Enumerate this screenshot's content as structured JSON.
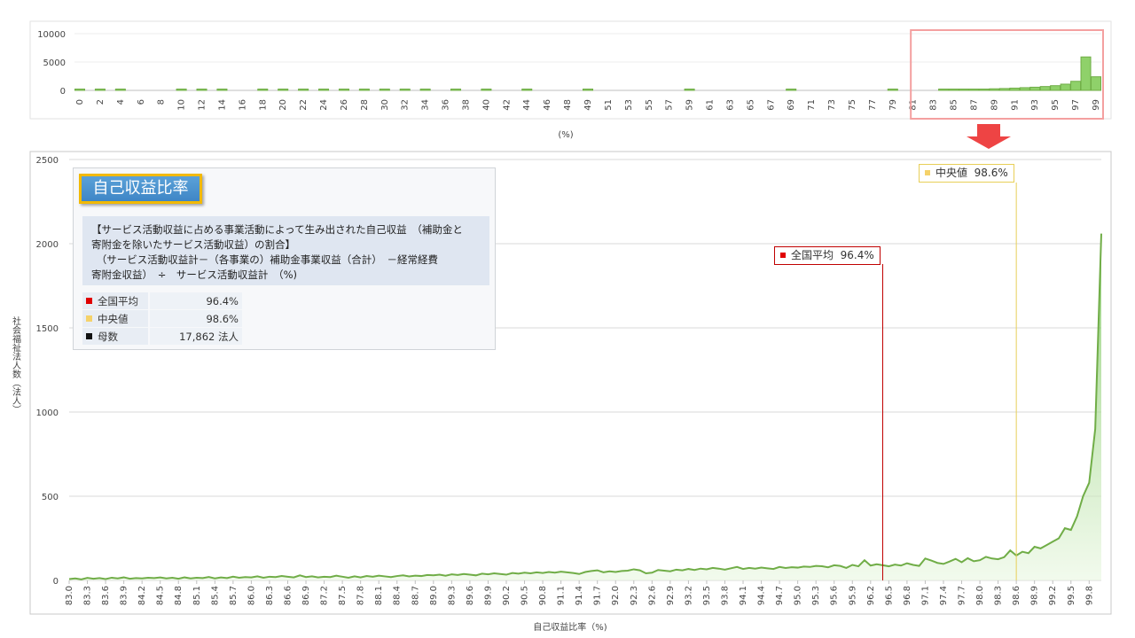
{
  "chart_data": [
    {
      "type": "bar",
      "name": "overview",
      "xlabel": "(%)",
      "ylim": [
        0,
        10000
      ],
      "yticks": [
        0,
        5000,
        10000
      ],
      "xticks": [
        "0",
        "2",
        "4",
        "6",
        "8",
        "10",
        "12",
        "14",
        "16",
        "18",
        "20",
        "22",
        "24",
        "26",
        "28",
        "30",
        "32",
        "34",
        "36",
        "38",
        "40",
        "42",
        "44",
        "46",
        "48",
        "49",
        "51",
        "53",
        "55",
        "57",
        "59",
        "61",
        "63",
        "65",
        "67",
        "69",
        "71",
        "73",
        "75",
        "77",
        "79",
        "81",
        "83",
        "85",
        "87",
        "89",
        "91",
        "93",
        "95",
        "97",
        "99"
      ],
      "highlight_range": [
        83,
        100
      ],
      "bars": [
        {
          "x": 0,
          "value": 40
        },
        {
          "x": 2,
          "value": 20
        },
        {
          "x": 4,
          "value": 20
        },
        {
          "x": 10,
          "value": 20
        },
        {
          "x": 12,
          "value": 20
        },
        {
          "x": 14,
          "value": 10
        },
        {
          "x": 18,
          "value": 20
        },
        {
          "x": 20,
          "value": 20
        },
        {
          "x": 22,
          "value": 30
        },
        {
          "x": 24,
          "value": 20
        },
        {
          "x": 26,
          "value": 20
        },
        {
          "x": 28,
          "value": 30
        },
        {
          "x": 30,
          "value": 20
        },
        {
          "x": 32,
          "value": 20
        },
        {
          "x": 34,
          "value": 30
        },
        {
          "x": 37,
          "value": 30
        },
        {
          "x": 40,
          "value": 30
        },
        {
          "x": 44,
          "value": 40
        },
        {
          "x": 50,
          "value": 40
        },
        {
          "x": 60,
          "value": 50
        },
        {
          "x": 70,
          "value": 60
        },
        {
          "x": 80,
          "value": 70
        },
        {
          "x": 85,
          "value": 100
        },
        {
          "x": 86,
          "value": 120
        },
        {
          "x": 87,
          "value": 150
        },
        {
          "x": 88,
          "value": 180
        },
        {
          "x": 89,
          "value": 220
        },
        {
          "x": 90,
          "value": 280
        },
        {
          "x": 91,
          "value": 330
        },
        {
          "x": 92,
          "value": 400
        },
        {
          "x": 93,
          "value": 480
        },
        {
          "x": 94,
          "value": 560
        },
        {
          "x": 95,
          "value": 680
        },
        {
          "x": 96,
          "value": 830
        },
        {
          "x": 97,
          "value": 1100
        },
        {
          "x": 98,
          "value": 1600
        },
        {
          "x": 99,
          "value": 5900
        },
        {
          "x": 100,
          "value": 2400
        }
      ]
    },
    {
      "type": "area",
      "name": "detail",
      "xlabel": "自己収益比率（%)",
      "ylabel": "社会福祉法人数（法人）",
      "ylim": [
        0,
        2500
      ],
      "yticks": [
        0,
        500,
        1000,
        1500,
        2000,
        2500
      ],
      "xlim": [
        83.0,
        100.0
      ],
      "xtick_labels": [
        "83.0",
        "83.3",
        "83.6",
        "83.9",
        "84.2",
        "84.5",
        "84.8",
        "85.1",
        "85.4",
        "85.7",
        "86.0",
        "86.3",
        "86.6",
        "86.9",
        "87.2",
        "87.5",
        "87.8",
        "88.1",
        "88.4",
        "88.7",
        "89.0",
        "89.3",
        "89.6",
        "89.9",
        "90.2",
        "90.5",
        "90.8",
        "91.1",
        "91.4",
        "91.7",
        "92.0",
        "92.3",
        "92.6",
        "92.9",
        "93.2",
        "93.5",
        "93.8",
        "94.1",
        "94.4",
        "94.7",
        "95.0",
        "95.3",
        "95.6",
        "95.9",
        "96.2",
        "96.5",
        "96.8",
        "97.1",
        "97.4",
        "97.7",
        "98.0",
        "98.3",
        "98.6",
        "98.9",
        "99.2",
        "99.5",
        "99.8"
      ],
      "x": [
        83.0,
        83.1,
        83.2,
        83.3,
        83.4,
        83.5,
        83.6,
        83.7,
        83.8,
        83.9,
        84.0,
        84.1,
        84.2,
        84.3,
        84.4,
        84.5,
        84.6,
        84.7,
        84.8,
        84.9,
        85.0,
        85.1,
        85.2,
        85.3,
        85.4,
        85.5,
        85.6,
        85.7,
        85.8,
        85.9,
        86.0,
        86.1,
        86.2,
        86.3,
        86.4,
        86.5,
        86.6,
        86.7,
        86.8,
        86.9,
        87.0,
        87.1,
        87.2,
        87.3,
        87.4,
        87.5,
        87.6,
        87.7,
        87.8,
        87.9,
        88.0,
        88.1,
        88.2,
        88.3,
        88.4,
        88.5,
        88.6,
        88.7,
        88.8,
        88.9,
        89.0,
        89.1,
        89.2,
        89.3,
        89.4,
        89.5,
        89.6,
        89.7,
        89.8,
        89.9,
        90.0,
        90.1,
        90.2,
        90.3,
        90.4,
        90.5,
        90.6,
        90.7,
        90.8,
        90.9,
        91.0,
        91.1,
        91.2,
        91.3,
        91.4,
        91.5,
        91.6,
        91.7,
        91.8,
        91.9,
        92.0,
        92.1,
        92.2,
        92.3,
        92.4,
        92.5,
        92.6,
        92.7,
        92.8,
        92.9,
        93.0,
        93.1,
        93.2,
        93.3,
        93.4,
        93.5,
        93.6,
        93.7,
        93.8,
        93.9,
        94.0,
        94.1,
        94.2,
        94.3,
        94.4,
        94.5,
        94.6,
        94.7,
        94.8,
        94.9,
        95.0,
        95.1,
        95.2,
        95.3,
        95.4,
        95.5,
        95.6,
        95.7,
        95.8,
        95.9,
        96.0,
        96.1,
        96.2,
        96.3,
        96.4,
        96.5,
        96.6,
        96.7,
        96.8,
        96.9,
        97.0,
        97.1,
        97.2,
        97.3,
        97.4,
        97.5,
        97.6,
        97.7,
        97.8,
        97.9,
        98.0,
        98.1,
        98.2,
        98.3,
        98.4,
        98.5,
        98.6,
        98.7,
        98.8,
        98.9,
        99.0,
        99.1,
        99.2,
        99.3,
        99.4,
        99.5,
        99.6,
        99.7,
        99.8,
        99.9,
        100.0
      ],
      "values": [
        8,
        12,
        6,
        15,
        10,
        14,
        8,
        16,
        12,
        18,
        10,
        14,
        12,
        16,
        14,
        18,
        12,
        16,
        10,
        18,
        12,
        16,
        14,
        20,
        12,
        18,
        14,
        22,
        16,
        20,
        18,
        24,
        16,
        22,
        20,
        26,
        22,
        18,
        30,
        20,
        24,
        18,
        22,
        20,
        28,
        22,
        16,
        24,
        18,
        26,
        22,
        28,
        24,
        20,
        26,
        30,
        24,
        28,
        26,
        32,
        30,
        34,
        28,
        36,
        32,
        38,
        34,
        30,
        40,
        36,
        42,
        38,
        34,
        44,
        40,
        46,
        42,
        48,
        44,
        50,
        46,
        52,
        48,
        44,
        38,
        50,
        56,
        60,
        48,
        54,
        50,
        56,
        58,
        66,
        60,
        42,
        46,
        62,
        58,
        54,
        64,
        60,
        68,
        62,
        70,
        66,
        74,
        70,
        64,
        72,
        80,
        68,
        74,
        70,
        76,
        72,
        68,
        80,
        74,
        78,
        76,
        82,
        80,
        86,
        84,
        78,
        90,
        86,
        74,
        92,
        84,
        120,
        88,
        96,
        90,
        84,
        94,
        88,
        102,
        92,
        86,
        130,
        118,
        104,
        98,
        112,
        128,
        108,
        132,
        114,
        120,
        140,
        130,
        126,
        138,
        178,
        148,
        170,
        162,
        200,
        190,
        210,
        230,
        250,
        310,
        300,
        380,
        500,
        580,
        900,
        2060,
        20
      ]
    }
  ],
  "stats_box": {
    "title": "自己収益比率",
    "definition_lines": [
      "【サービス活動収益に占める事業活動によって生み出された自己収益　（補助金と",
      "寄附金を除いたサービス活動収益）の割合】",
      "　（サービス活動収益計－（各事業の）補助金事業収益（合計）　－経常経費",
      "寄附金収益）　÷　サービス活動収益計　（%)"
    ],
    "rows": [
      {
        "label": "全国平均",
        "value": "96.4%",
        "color": "#e00000"
      },
      {
        "label": "中央値",
        "value": "98.6%",
        "color": "#f5d26a"
      },
      {
        "label": "母数",
        "value": "17,862  法人",
        "color": "#111111"
      }
    ]
  },
  "markers": {
    "mean": {
      "label": "全国平均",
      "value_text": "96.4%",
      "x": 96.4,
      "color": "#c00000"
    },
    "median": {
      "label": "中央値",
      "value_text": "98.6%",
      "x": 98.6,
      "color": "#e8cf58"
    }
  },
  "colors": {
    "series": "#70ad47",
    "fill_top": "#8fd16a",
    "highlight_box": "#f4a0a0",
    "arrow": "#ee4444",
    "grid": "#d9d9d9"
  }
}
